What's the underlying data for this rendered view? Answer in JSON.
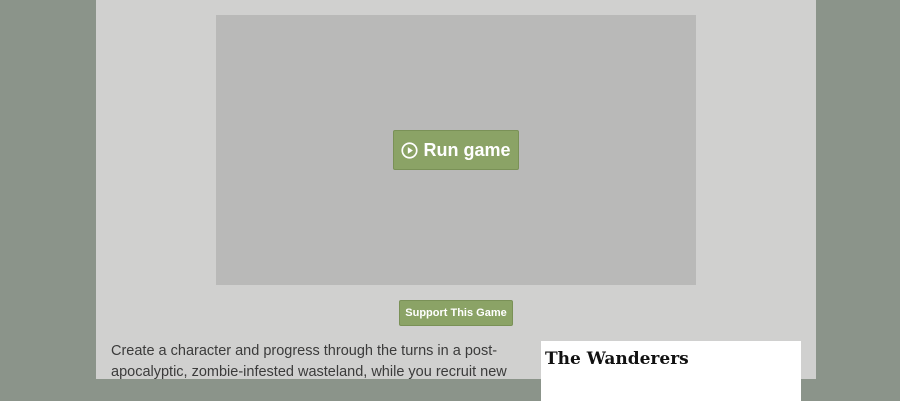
{
  "game": {
    "run_label": "Run game",
    "run_icon": "play-circle-icon"
  },
  "support": {
    "label": "Support This Game"
  },
  "description": {
    "text": "Create a character and progress through the turns in a post-apocalyptic, zombie-infested wasteland, while you recruit new"
  },
  "info_panel": {
    "title": "The Wanderers"
  },
  "colors": {
    "background": "#8b948a",
    "page": "#d0d0cf",
    "frame": "#b9b9b8",
    "button": "#8ba366"
  }
}
